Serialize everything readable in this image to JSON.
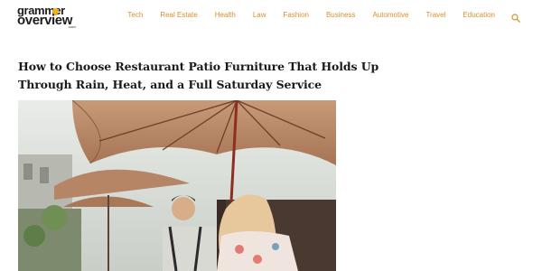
{
  "site": {
    "logo_line1": "grammer",
    "logo_line2": "overview",
    "logo_suffix": ".com"
  },
  "nav": {
    "items": [
      "Tech",
      "Real Estate",
      "Health",
      "Law",
      "Fashion",
      "Business",
      "Automotive",
      "Travel",
      "Education"
    ],
    "search_icon": "search-icon"
  },
  "article": {
    "title": "How to Choose Restaurant Patio Furniture That Holds Up Through Rain, Heat, and a Full Saturday Service"
  },
  "colors": {
    "accent": "#d4922a",
    "text": "#1a1a1a",
    "umbrella": "#b98866"
  }
}
